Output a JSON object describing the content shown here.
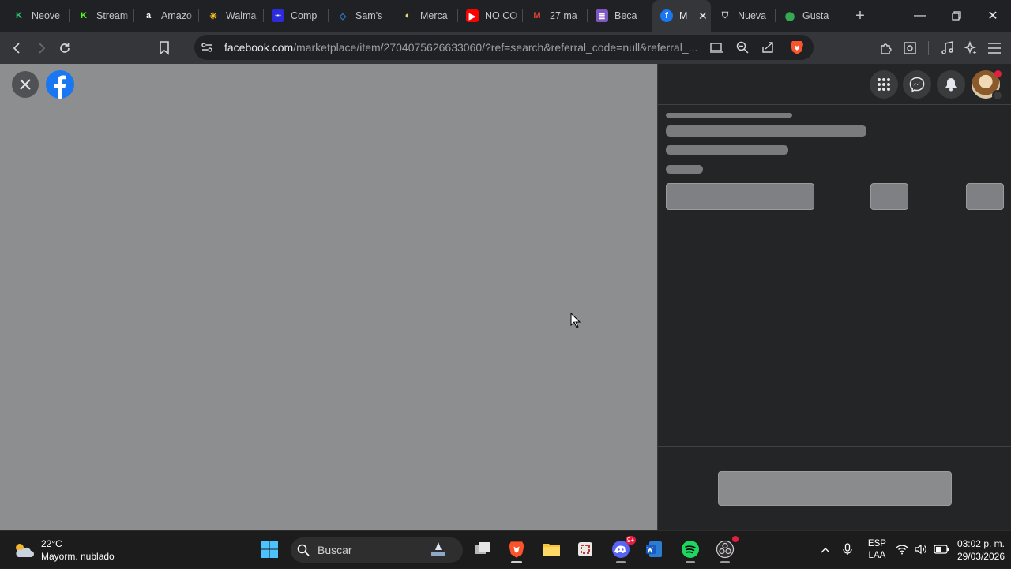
{
  "browser": {
    "tabs": [
      {
        "label": "Neove",
        "icon": "keeper-icon",
        "color": "#2ecc71"
      },
      {
        "label": "Stream",
        "icon": "kick-icon",
        "color": "#53fc18"
      },
      {
        "label": "Amazo",
        "icon": "amazon-icon",
        "color": "#ffffff"
      },
      {
        "label": "Walma",
        "icon": "walmart-icon",
        "color": "#ffc220"
      },
      {
        "label": "Comp",
        "icon": "app-icon",
        "color": "#2b2bd9"
      },
      {
        "label": "Sam's",
        "icon": "sams-icon",
        "color": "#2f7fd1"
      },
      {
        "label": "Merca",
        "icon": "mercadolibre-icon",
        "color": "#f5e16b"
      },
      {
        "label": "NO CO",
        "icon": "youtube-icon",
        "color": "#ff0000"
      },
      {
        "label": "27 ma",
        "icon": "gmail-icon",
        "color": "#ea4335"
      },
      {
        "label": "Beca",
        "icon": "forms-icon",
        "color": "#7e57c2"
      },
      {
        "label": "M",
        "icon": "facebook-icon",
        "color": "#1877f2",
        "active": true
      },
      {
        "label": "Nueva",
        "icon": "brave-shield-icon",
        "color": "#cfcfcf"
      },
      {
        "label": "Gusta",
        "icon": "maps-pin-icon",
        "color": "#34a853"
      }
    ],
    "url_host": "facebook.com",
    "url_path": "/marketplace/item/2704075626633060/?ref=search&referral_code=null&referral_..."
  },
  "taskbar": {
    "temperature": "22°C",
    "weather_desc": "Mayorm. nublado",
    "search_label": "Buscar",
    "lang_line1": "ESP",
    "lang_line2": "LAA",
    "time": "03:02 p. m.",
    "date": "29/03/2026",
    "discord_badge": "9+"
  },
  "colors": {
    "accent": "#1877f2",
    "viewer_bg": "#8d8e90",
    "panel_bg": "#242526"
  }
}
